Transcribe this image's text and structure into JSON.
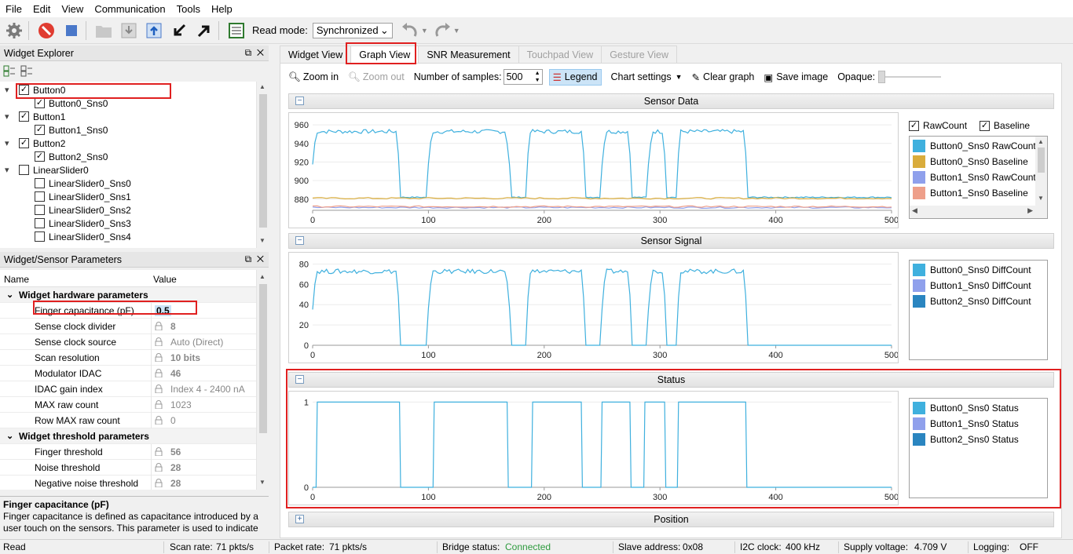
{
  "menu": [
    "File",
    "Edit",
    "View",
    "Communication",
    "Tools",
    "Help"
  ],
  "toolbar": {
    "read_mode_label": "Read mode:",
    "read_mode_value": "Synchronized"
  },
  "explorer": {
    "title": "Widget Explorer",
    "items": [
      {
        "label": "Button0",
        "checked": true,
        "level": 0,
        "exp": "▾"
      },
      {
        "label": "Button0_Sns0",
        "checked": true,
        "level": 1
      },
      {
        "label": "Button1",
        "checked": true,
        "level": 0,
        "exp": "▾"
      },
      {
        "label": "Button1_Sns0",
        "checked": true,
        "level": 1
      },
      {
        "label": "Button2",
        "checked": true,
        "level": 0,
        "exp": "▾"
      },
      {
        "label": "Button2_Sns0",
        "checked": true,
        "level": 1
      },
      {
        "label": "LinearSlider0",
        "checked": false,
        "level": 0,
        "exp": "▾"
      },
      {
        "label": "LinearSlider0_Sns0",
        "checked": false,
        "level": 1
      },
      {
        "label": "LinearSlider0_Sns1",
        "checked": false,
        "level": 1
      },
      {
        "label": "LinearSlider0_Sns2",
        "checked": false,
        "level": 1
      },
      {
        "label": "LinearSlider0_Sns3",
        "checked": false,
        "level": 1
      },
      {
        "label": "LinearSlider0_Sns4",
        "checked": false,
        "level": 1
      }
    ]
  },
  "params": {
    "title": "Widget/Sensor Parameters",
    "col_name": "Name",
    "col_value": "Value",
    "rows": [
      {
        "type": "group",
        "name": "Widget hardware parameters"
      },
      {
        "name": "Finger capacitance (pF)",
        "value": "0.5",
        "editable": true
      },
      {
        "name": "Sense clock divider",
        "value": "8",
        "bold": true
      },
      {
        "name": "Sense clock source",
        "value": "Auto (Direct)"
      },
      {
        "name": "Scan resolution",
        "value": "10 bits",
        "bold": true
      },
      {
        "name": "Modulator IDAC",
        "value": "46",
        "bold": true
      },
      {
        "name": "IDAC gain index",
        "value": "Index 4 - 2400 nA"
      },
      {
        "name": "MAX raw count",
        "value": "1023"
      },
      {
        "name": "Row MAX raw count",
        "value": "0"
      },
      {
        "type": "group",
        "name": "Widget threshold parameters"
      },
      {
        "name": "Finger threshold",
        "value": "56",
        "bold": true
      },
      {
        "name": "Noise threshold",
        "value": "28",
        "bold": true
      },
      {
        "name": "Negative noise threshold",
        "value": "28",
        "bold": true
      }
    ],
    "desc_title": "Finger capacitance (pF)",
    "desc_text": "Finger capacitance is defined as capacitance introduced by a user touch on the sensors. This parameter is used to indicate"
  },
  "tabs": [
    {
      "label": "Widget View",
      "state": "normal"
    },
    {
      "label": "Graph View",
      "state": "active"
    },
    {
      "label": "SNR Measurement",
      "state": "normal"
    },
    {
      "label": "Touchpad View",
      "state": "disabled"
    },
    {
      "label": "Gesture View",
      "state": "disabled"
    }
  ],
  "graph_toolbar": {
    "zoom_in": "Zoom in",
    "zoom_out": "Zoom out",
    "samples_label": "Number of samples:",
    "samples_value": "500",
    "legend": "Legend",
    "chart_settings": "Chart settings",
    "clear_graph": "Clear graph",
    "save_image": "Save image",
    "opaque": "Opaque:"
  },
  "sections": {
    "sensor_data": "Sensor Data",
    "sensor_signal": "Sensor Signal",
    "status": "Status",
    "position": "Position"
  },
  "legend_options": {
    "rawcount": "RawCount",
    "baseline": "Baseline"
  },
  "legends": {
    "sensor_data": [
      {
        "name": "Button0_Sns0 RawCount",
        "color": "#3fb0de"
      },
      {
        "name": "Button0_Sns0 Baseline",
        "color": "#d9ac3c"
      },
      {
        "name": "Button1_Sns0 RawCount",
        "color": "#8fa0ec"
      },
      {
        "name": "Button1_Sns0 Baseline",
        "color": "#ee9f8a"
      }
    ],
    "sensor_signal": [
      {
        "name": "Button0_Sns0 DiffCount",
        "color": "#3fb0de"
      },
      {
        "name": "Button1_Sns0 DiffCount",
        "color": "#8fa0ec"
      },
      {
        "name": "Button2_Sns0 DiffCount",
        "color": "#2a85c0"
      }
    ],
    "status": [
      {
        "name": "Button0_Sns0 Status",
        "color": "#3fb0de"
      },
      {
        "name": "Button1_Sns0 Status",
        "color": "#8fa0ec"
      },
      {
        "name": "Button2_Sns0 Status",
        "color": "#2a85c0"
      }
    ]
  },
  "chart_data": [
    {
      "type": "line",
      "title": "Sensor Data",
      "x_ticks": [
        0,
        100,
        200,
        300,
        400,
        500
      ],
      "y_ticks": [
        880,
        900,
        920,
        940,
        960
      ],
      "xlim": [
        0,
        500
      ],
      "ylim": [
        868,
        966
      ],
      "touch_intervals": [
        [
          0,
          75
        ],
        [
          100,
          170
        ],
        [
          185,
          235
        ],
        [
          250,
          275
        ],
        [
          290,
          305
        ],
        [
          315,
          375
        ]
      ],
      "series": [
        {
          "name": "Button0_Sns0 RawCount",
          "color": "#3fb0de",
          "low": 882,
          "high": 955
        },
        {
          "name": "Button0_Sns0 Baseline",
          "color": "#d9ac3c",
          "level": 881
        },
        {
          "name": "Button1_Sns0 RawCount",
          "color": "#8fa0ec",
          "level": 871
        },
        {
          "name": "Button1_Sns0 Baseline",
          "color": "#ee9f8a",
          "level": 872
        }
      ]
    },
    {
      "type": "line",
      "title": "Sensor Signal",
      "x_ticks": [
        0,
        100,
        200,
        300,
        400,
        500
      ],
      "y_ticks": [
        0,
        20,
        40,
        60,
        80
      ],
      "xlim": [
        0,
        500
      ],
      "ylim": [
        0,
        85
      ],
      "touch_intervals": [
        [
          0,
          75
        ],
        [
          100,
          170
        ],
        [
          185,
          235
        ],
        [
          250,
          275
        ],
        [
          290,
          305
        ],
        [
          315,
          375
        ]
      ],
      "series": [
        {
          "name": "Button0_Sns0 DiffCount",
          "color": "#3fb0de",
          "low": 0,
          "high": 75
        }
      ]
    },
    {
      "type": "line",
      "title": "Status",
      "x_ticks": [
        0,
        100,
        200,
        300,
        400,
        500
      ],
      "y_ticks": [
        0,
        1
      ],
      "xlim": [
        0,
        500
      ],
      "ylim": [
        0,
        1.05
      ],
      "touch_intervals": [
        [
          4,
          75
        ],
        [
          105,
          168
        ],
        [
          190,
          232
        ],
        [
          250,
          274
        ],
        [
          287,
          304
        ],
        [
          316,
          374
        ]
      ],
      "series": [
        {
          "name": "Button0_Sns0 Status",
          "color": "#3fb0de",
          "low": 0,
          "high": 1
        }
      ]
    }
  ],
  "statusbar": {
    "read": "Read",
    "scan_rate": "Scan rate:",
    "scan_rate_val": "71 pkts/s",
    "packet_rate": "Packet rate:",
    "packet_rate_val": "71 pkts/s",
    "bridge": "Bridge status:",
    "bridge_val": "Connected",
    "slave": "Slave address:",
    "slave_val": "0x08",
    "i2c": "I2C clock:",
    "i2c_val": "400 kHz",
    "supply": "Supply voltage:",
    "supply_val": "4.709 V",
    "logging": "Logging:",
    "logging_val": "OFF"
  }
}
